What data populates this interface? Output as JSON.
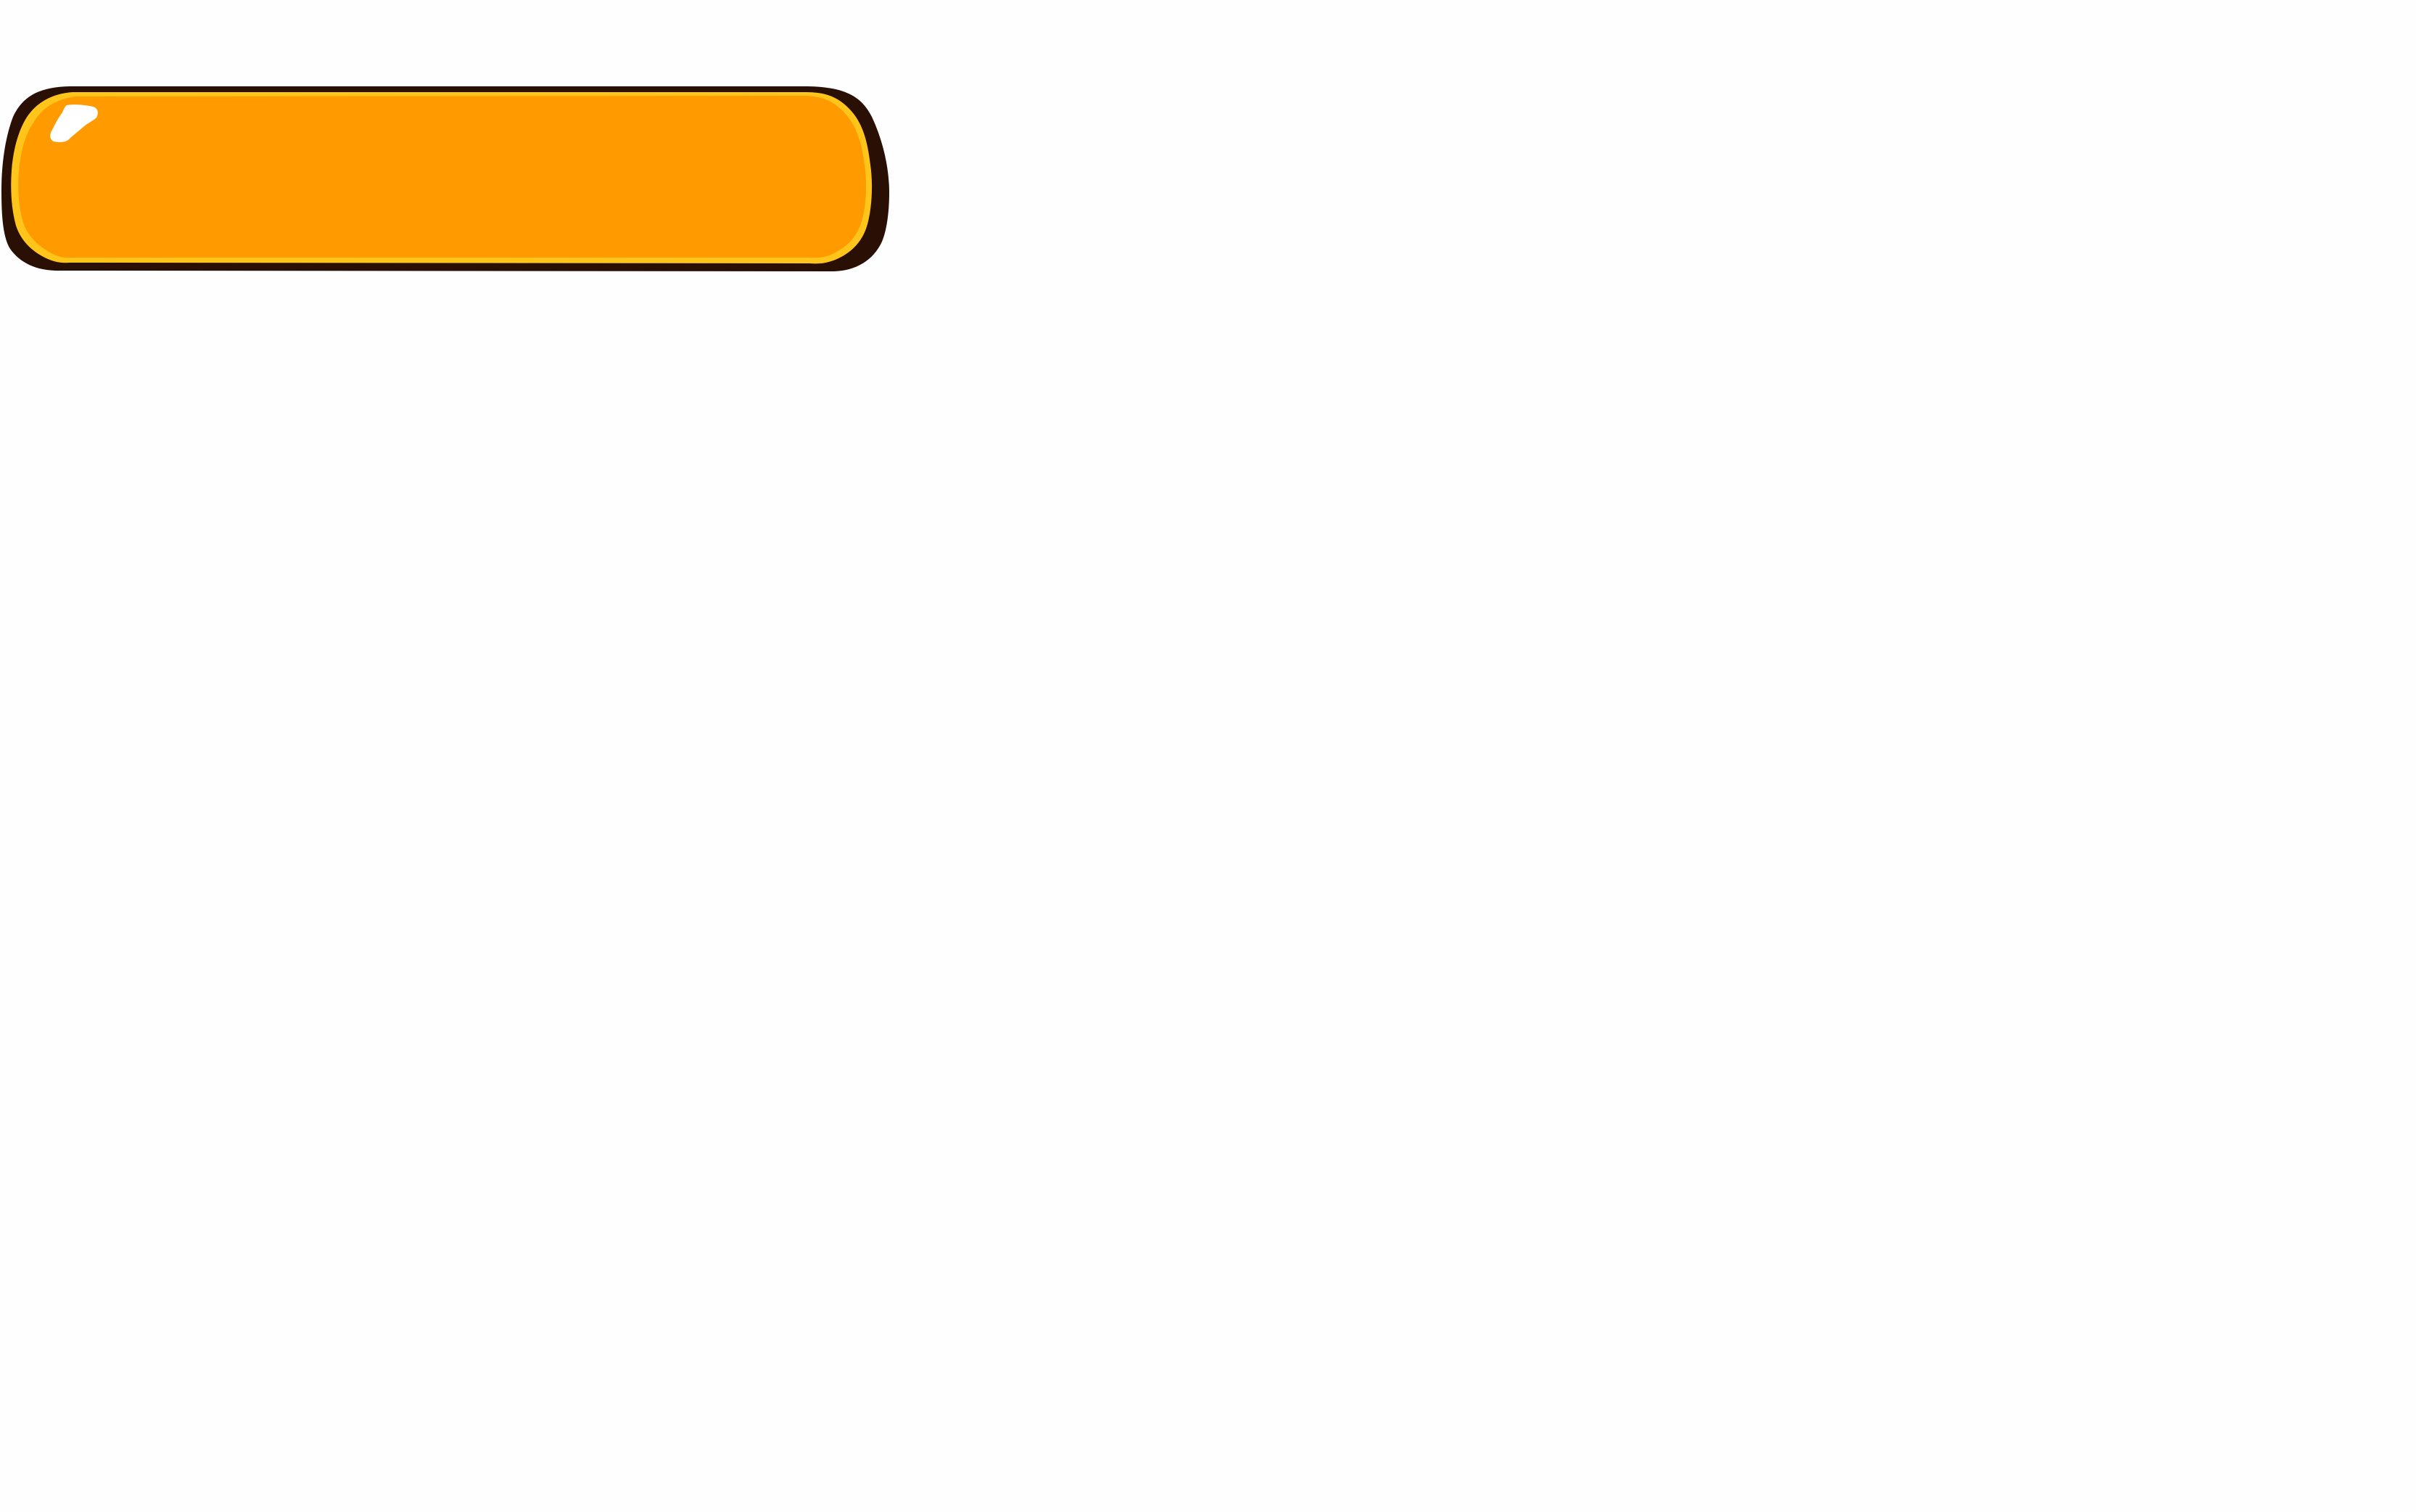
{
  "game_button": {
    "label": "",
    "state": "normal",
    "colors": {
      "fill": "#ff9b00",
      "outline": "#2a0f05",
      "inner_rim": "#ffc51a",
      "highlight": "#ffffff",
      "background": "#fefefe"
    }
  }
}
